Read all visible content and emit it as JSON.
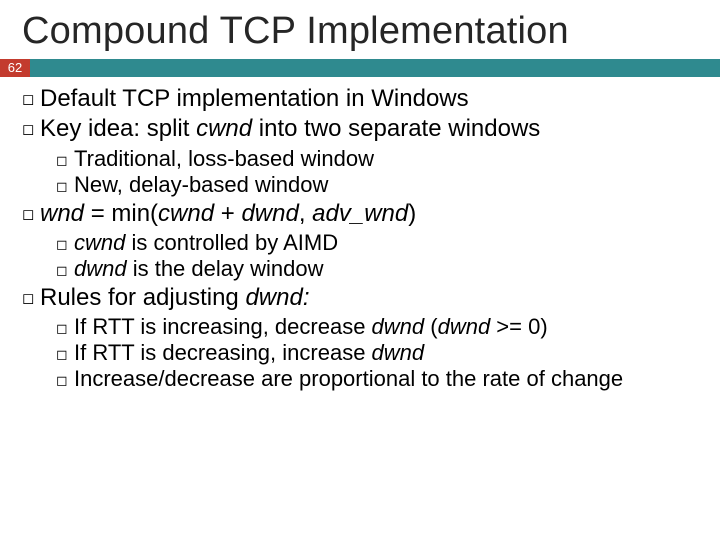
{
  "title": "Compound TCP Implementation",
  "slide_number": "62",
  "b1": "Default TCP implementation in Windows",
  "b2_a": "Key idea: split ",
  "b2_i": "cwnd",
  "b2_c": " into two separate windows",
  "b2s1": "Traditional, loss-based window",
  "b2s2": "New, delay-based window",
  "b3_i1": "wnd",
  "b3_a": " = min(",
  "b3_i2": "cwnd",
  "b3_b": " + ",
  "b3_i3": "dwnd",
  "b3_c": ", ",
  "b3_i4": "adv_wnd",
  "b3_d": ")",
  "b3s1_i": "cwnd",
  "b3s1_t": " is controlled by AIMD",
  "b3s2_i": "dwnd",
  "b3s2_t": " is the delay window",
  "b4_a": "Rules for adjusting ",
  "b4_i": "dwnd:",
  "b4s1_a": "If RTT is increasing, decrease ",
  "b4s1_i1": "dwnd",
  "b4s1_b": " (",
  "b4s1_i2": "dwnd",
  "b4s1_c": " >= 0)",
  "b4s2_a": "If RTT is decreasing, increase ",
  "b4s2_i": "dwnd",
  "b4s3": "Increase/decrease are proportional to the rate of change"
}
